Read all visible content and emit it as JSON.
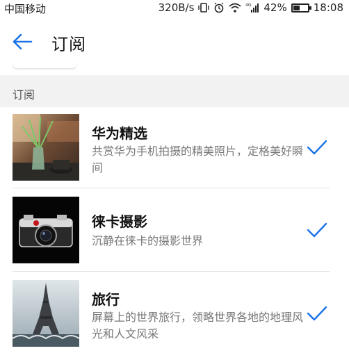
{
  "status_bar": {
    "carrier": "中国移动",
    "speed": "320B/s",
    "battery_text": "42%",
    "battery_level": 0.42,
    "time": "18:08"
  },
  "header": {
    "title": "订阅"
  },
  "section": {
    "label": "订阅"
  },
  "items": [
    {
      "name": "华为精选",
      "description": "共赏华为手机拍摄的精美照片，定格美好瞬间",
      "subscribed": true
    },
    {
      "name": "徕卡摄影",
      "description": "沉静在徕卡的摄影世界",
      "subscribed": true
    },
    {
      "name": "旅行",
      "description": "屏幕上的世界旅行，领略世界各地的地理风光和人文风采",
      "subscribed": true
    }
  ],
  "colors": {
    "accent": "#1a73e8",
    "section_bg": "#f2f2f2"
  }
}
